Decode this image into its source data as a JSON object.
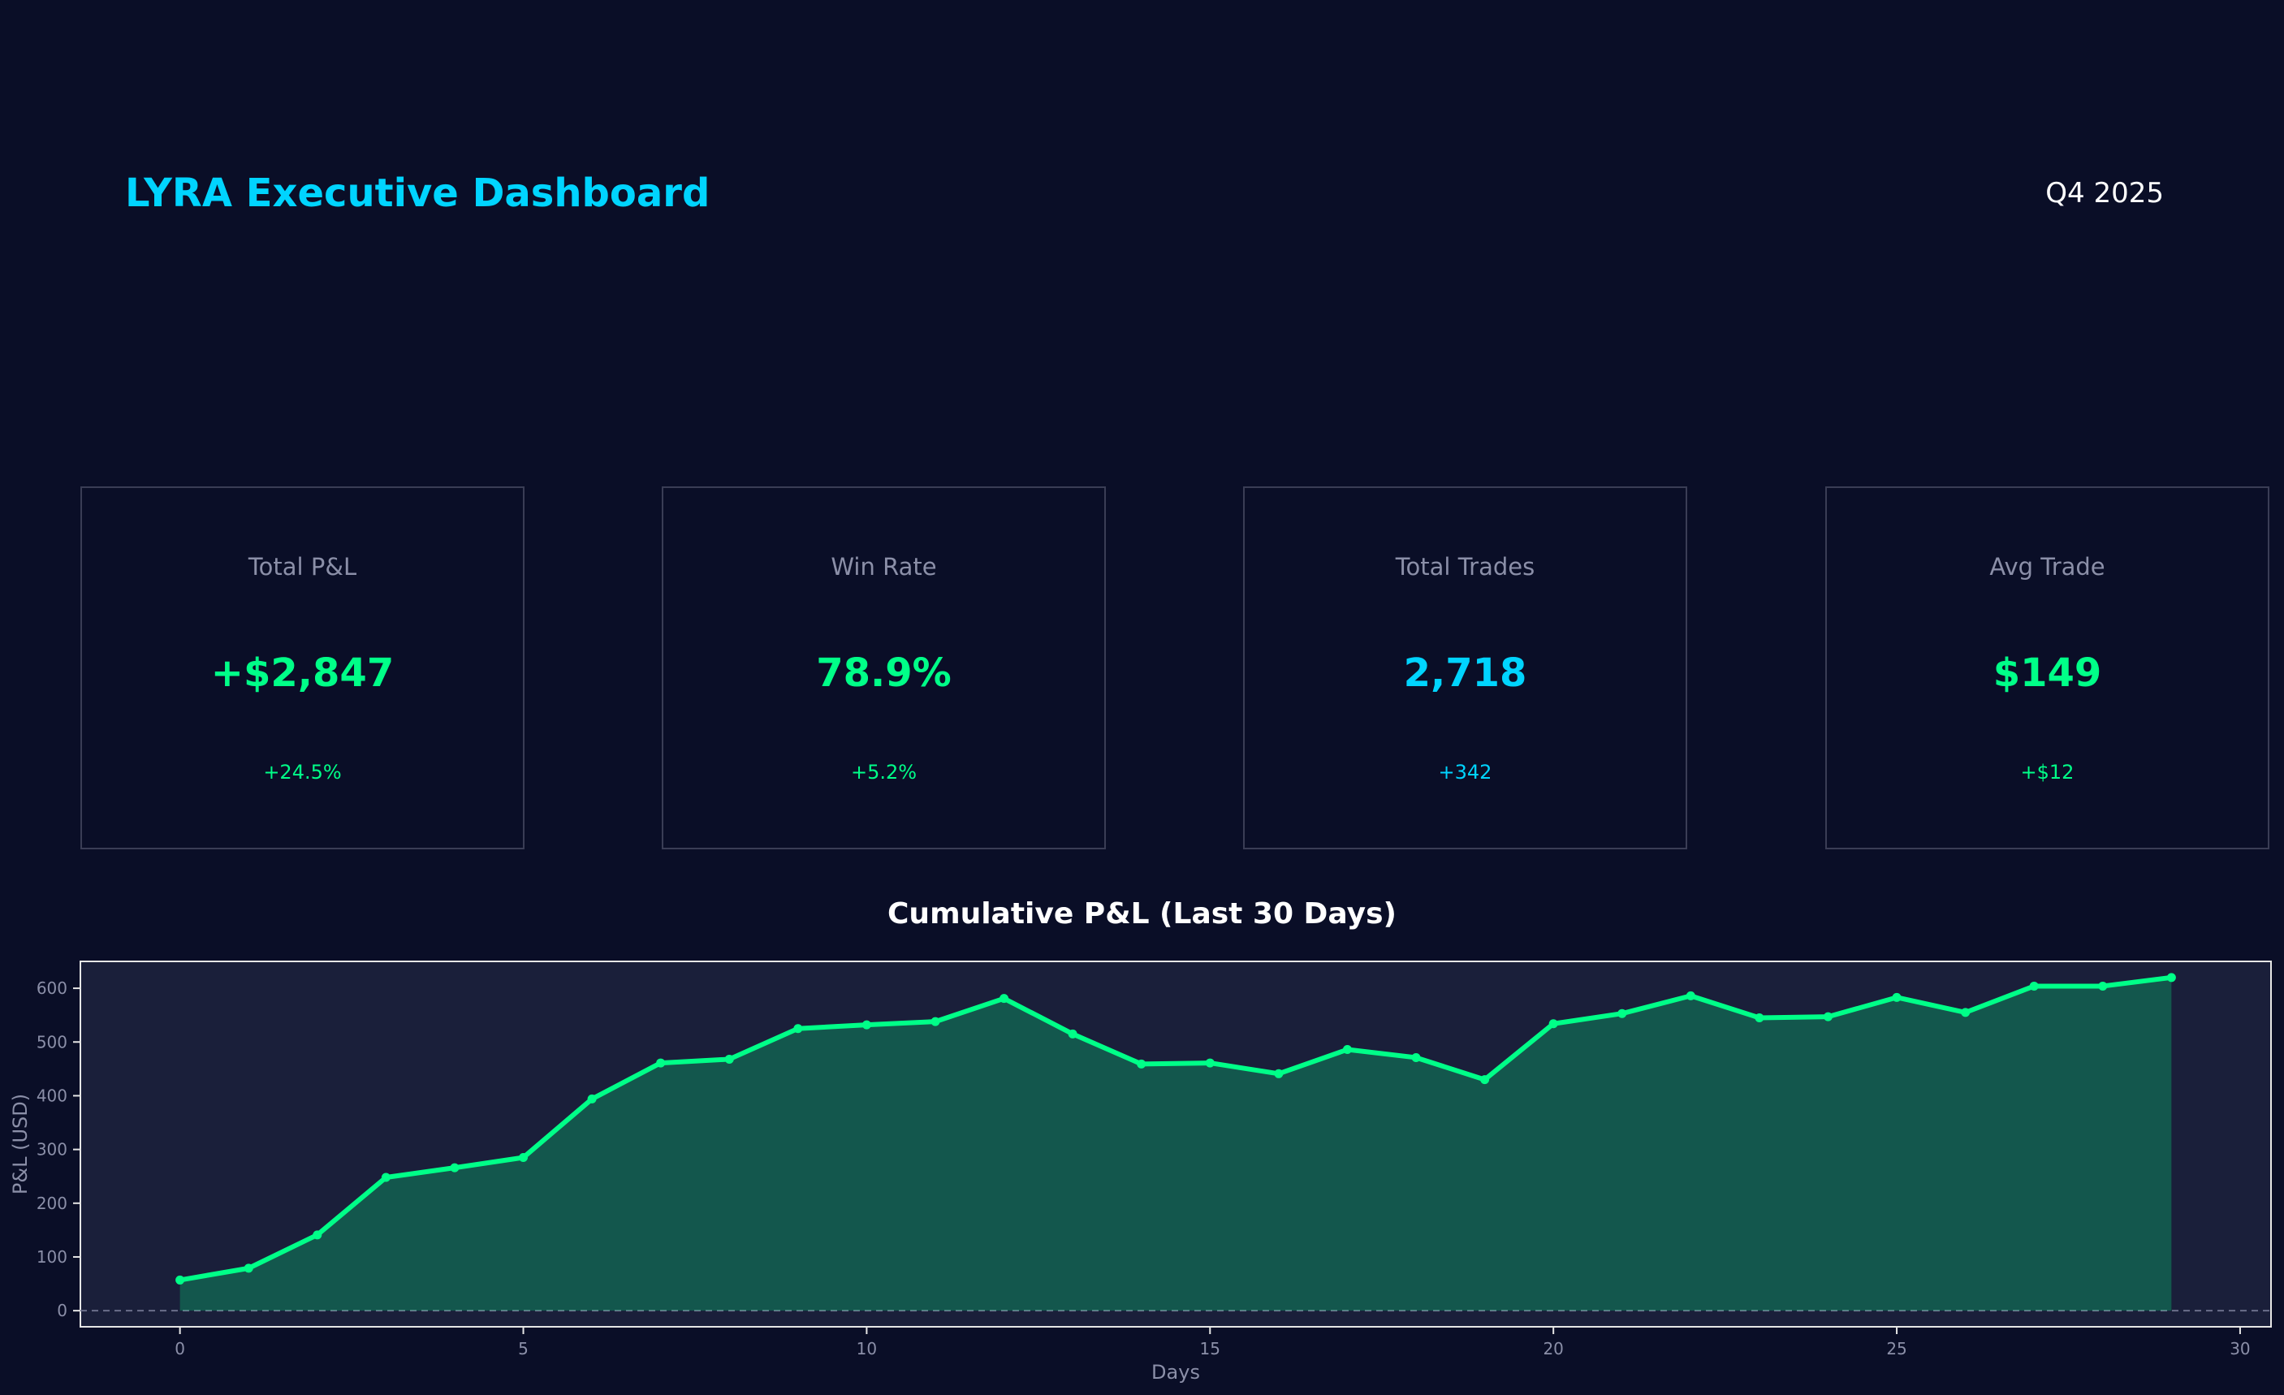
{
  "header": {
    "title": "LYRA Executive Dashboard",
    "period": "Q4 2025"
  },
  "colors": {
    "background": "#0a0e27",
    "panel": "#1a1f3a",
    "accent_cyan": "#00d4ff",
    "accent_green": "#00ff88",
    "muted": "#8b8fa8",
    "border": "#3a3d55"
  },
  "kpis": [
    {
      "label": "Total P&L",
      "value": "+$2,847",
      "delta": "+24.5%",
      "color": "#00ff88"
    },
    {
      "label": "Win Rate",
      "value": "78.9%",
      "delta": "+5.2%",
      "color": "#00ff88"
    },
    {
      "label": "Total Trades",
      "value": "2,718",
      "delta": "+342",
      "color": "#00d4ff"
    },
    {
      "label": "Avg Trade",
      "value": "$149",
      "delta": "+$12",
      "color": "#00ff88"
    }
  ],
  "chart_data": {
    "type": "area",
    "title": "Cumulative P&L (Last 30 Days)",
    "xlabel": "Days",
    "ylabel": "P&L (USD)",
    "xlim": [
      -1.45,
      30.45
    ],
    "ylim": [
      -30,
      650
    ],
    "xticks": [
      0,
      5,
      10,
      15,
      20,
      25,
      30
    ],
    "yticks": [
      0,
      100,
      200,
      300,
      400,
      500,
      600
    ],
    "grid": false,
    "zero_line": true,
    "series": [
      {
        "color": "#00ff88",
        "x": [
          0,
          1,
          2,
          3,
          4,
          5,
          6,
          7,
          8,
          9,
          10,
          11,
          12,
          13,
          14,
          15,
          16,
          17,
          18,
          19,
          20,
          21,
          22,
          23,
          24,
          25,
          26,
          27,
          28,
          29
        ],
        "y": [
          57,
          79,
          141,
          248,
          266,
          285,
          394,
          461,
          468,
          525,
          532,
          538,
          581,
          515,
          459,
          461,
          441,
          486,
          471,
          430,
          534,
          553,
          586,
          545,
          547,
          583,
          555,
          604,
          604,
          620
        ]
      }
    ]
  }
}
